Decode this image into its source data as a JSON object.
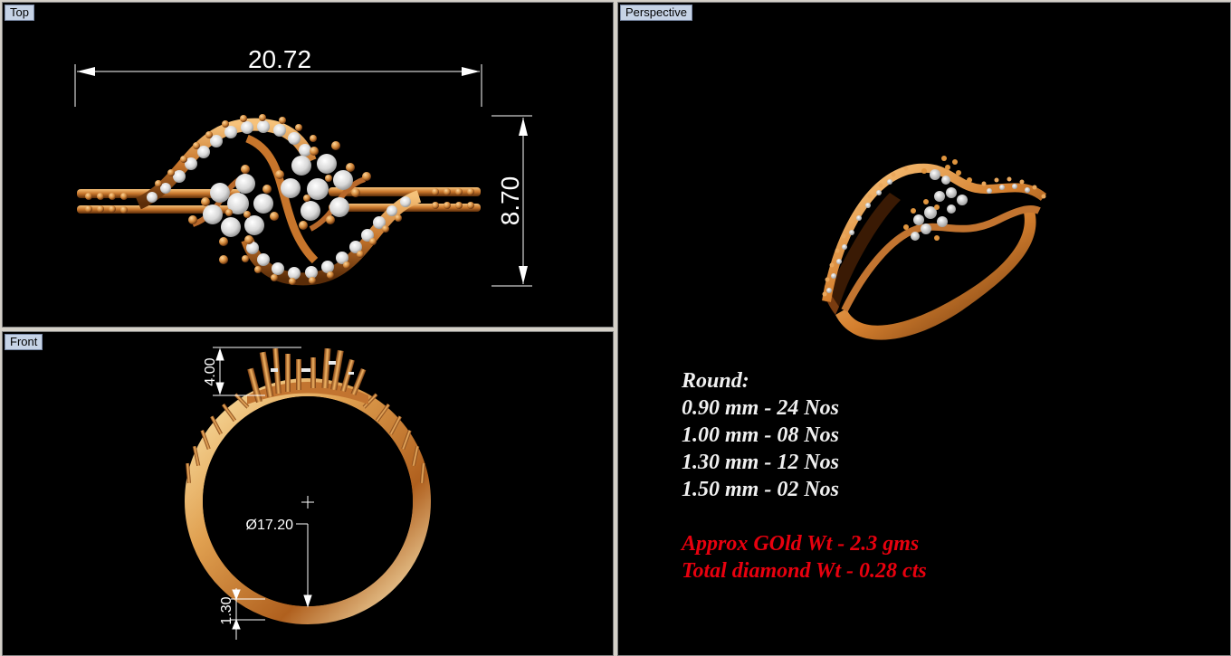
{
  "viewports": {
    "top": {
      "label": "Top",
      "dim_width": "20.72",
      "dim_height": "8.70"
    },
    "front": {
      "label": "Front",
      "dim_head_height": "4.00",
      "dim_diameter": "Ø17.20",
      "dim_shank_thickness": "1.30"
    },
    "perspective": {
      "label": "Perspective"
    }
  },
  "specs": {
    "heading": "Round:",
    "lines": [
      "0.90 mm - 24 Nos",
      "1.00 mm - 08 Nos",
      "1.30 mm - 12 Nos",
      "1.50 mm - 02 Nos"
    ],
    "gold_weight": "Approx GOld Wt - 2.3 gms",
    "diamond_weight": "Total diamond Wt - 0.28 cts"
  },
  "colors": {
    "viewport_bg": "#000000",
    "label_bg": "#c6d3e6",
    "gold": "#d88a3a",
    "diamond": "#eeeeee",
    "dimension": "#ffffff",
    "warning_text": "#e8000e"
  }
}
